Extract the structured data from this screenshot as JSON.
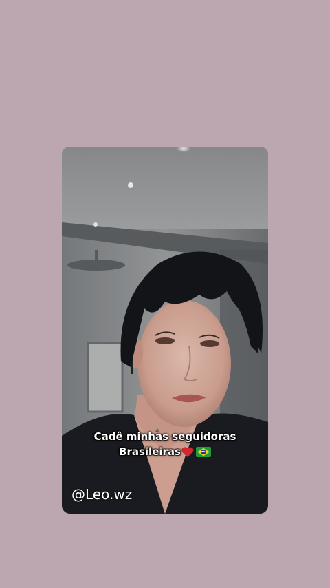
{
  "story": {
    "caption_line1": "Cadê minhas seguidoras",
    "caption_line2": "Brasileiras",
    "caption_emojis": [
      "red-heart-icon",
      "brazil-flag-icon"
    ],
    "handle": "@Leo.wz"
  },
  "colors": {
    "page_background": "#bca7b0",
    "caption_text": "#ffffff",
    "heart": "#d8262e",
    "flag_green": "#1f9a3c",
    "flag_yellow": "#f7d21b",
    "flag_blue": "#1e3b8a"
  }
}
